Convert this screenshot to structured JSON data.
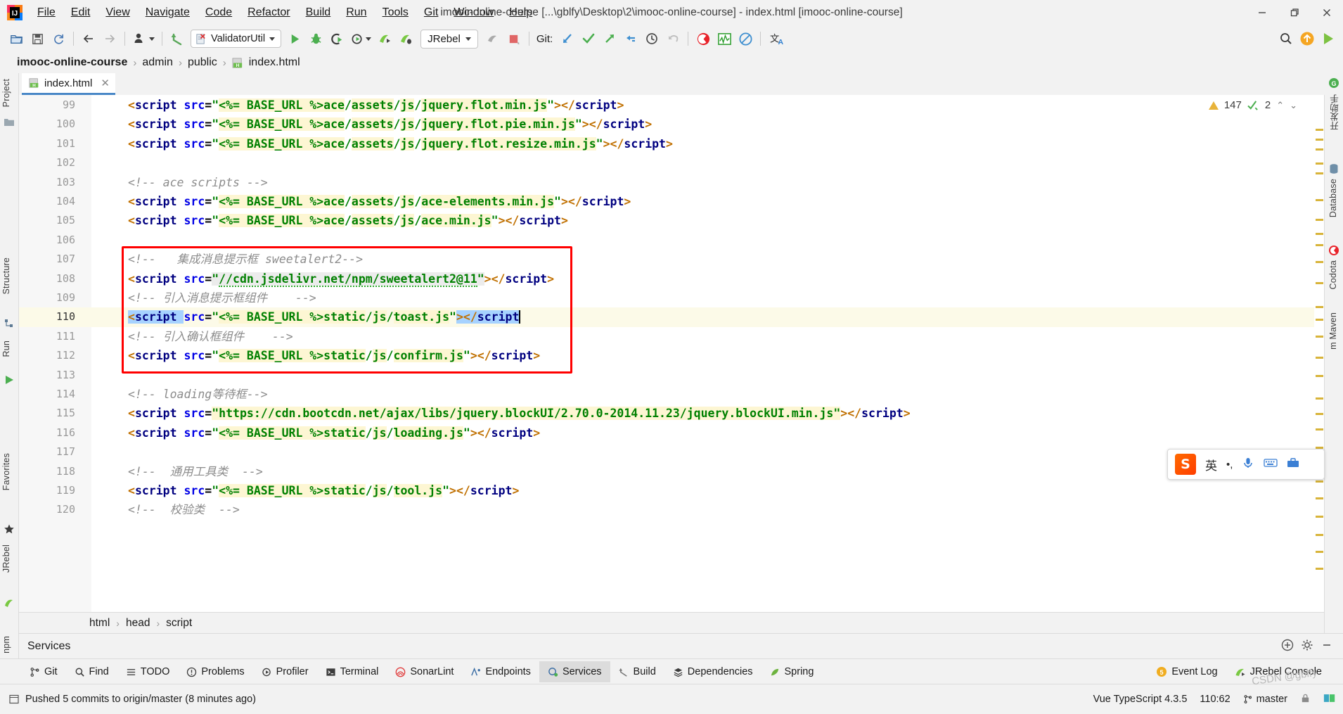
{
  "window": {
    "title": "imooc-online-course [...\\gblfy\\Desktop\\2\\imooc-online-course] - index.html [imooc-online-course]",
    "minimize": "—",
    "maximize": "❐",
    "close": "✕"
  },
  "menu": [
    {
      "label": "File"
    },
    {
      "label": "Edit"
    },
    {
      "label": "View"
    },
    {
      "label": "Navigate"
    },
    {
      "label": "Code"
    },
    {
      "label": "Refactor"
    },
    {
      "label": "Build"
    },
    {
      "label": "Run"
    },
    {
      "label": "Tools"
    },
    {
      "label": "Git"
    },
    {
      "label": "Window"
    },
    {
      "label": "Help"
    }
  ],
  "toolbar": {
    "run_config": "ValidatorUtil",
    "jrebel": "JRebel",
    "git_label": "Git:",
    "icons": [
      "open-folder-icon",
      "save-all-icon",
      "sync-icon",
      "back-icon",
      "forward-icon",
      "profile-icon",
      "undo-arrow-icon",
      "run-icon",
      "debug-icon",
      "run-with-coverage-icon",
      "profiler-icon",
      "jrebel-run-icon",
      "jrebel-debug-icon",
      "stop-icon",
      "pause-icon",
      "git-update-icon",
      "git-commit-icon",
      "git-push-icon",
      "git-pull-icon",
      "git-history-icon",
      "git-rollback-icon",
      "codota-icon",
      "monitor-icon",
      "block-icon",
      "translate-icon",
      "search-everywhere-icon",
      "upload-icon",
      "play-green-icon"
    ]
  },
  "breadcrumb": {
    "items": [
      "imooc-online-course",
      "admin",
      "public",
      "index.html"
    ],
    "separator": "›",
    "file_icon": "html-file-icon"
  },
  "tab": {
    "label": "index.html",
    "icon": "html-file-icon",
    "close": "✕"
  },
  "left_stripe": [
    {
      "label": "Project",
      "name": "tool-window-project"
    },
    {
      "label": "Structure",
      "name": "tool-window-structure"
    },
    {
      "label": "Run",
      "name": "tool-window-run"
    },
    {
      "label": "Favorites",
      "name": "tool-window-favorites"
    },
    {
      "label": "JRebel",
      "name": "tool-window-jrebel"
    },
    {
      "label": "npm",
      "name": "tool-window-npm"
    }
  ],
  "right_stripe": [
    {
      "label": "开发助手",
      "name": "tool-window-dev-helper"
    },
    {
      "label": "Database",
      "name": "tool-window-database"
    },
    {
      "label": "Codota",
      "name": "tool-window-codota"
    },
    {
      "label": "m Maven",
      "name": "tool-window-maven"
    }
  ],
  "inspection": {
    "warning_count": "147",
    "check_count": "2",
    "warning_icon": "warning-triangle-icon",
    "check_icon": "inspection-check-icon",
    "up_chevron": "⌃",
    "down_chevron": "⌄"
  },
  "code": {
    "first_line": 99,
    "current_line": 110,
    "lines": [
      {
        "n": 99,
        "html": "<span class=\"t-angle\">&lt;</span><span class=\"t-tag\">script </span><span class=\"t-attr\">src</span><span class=\"t-eq\">=</span><span class=\"t-str\">\"</span><span class=\"hl\"><span class=\"t-str\">&lt;%= BASE_URL %&gt;ace</span></span><span class=\"t-str\">/</span><span class=\"hl\"><span class=\"t-str\">assets</span></span><span class=\"t-str\">/</span><span class=\"hl\"><span class=\"t-str\">js</span></span><span class=\"t-str\">/</span><span class=\"hl\"><span class=\"t-str\">jquery.flot.min.js</span></span><span class=\"t-str\">\"</span><span class=\"t-angle\">&gt;&lt;/</span><span class=\"t-tag\">script</span><span class=\"t-angle\">&gt;</span>"
      },
      {
        "n": 100,
        "html": "<span class=\"t-angle\">&lt;</span><span class=\"t-tag\">script </span><span class=\"t-attr\">src</span><span class=\"t-eq\">=</span><span class=\"t-str\">\"</span><span class=\"hl\"><span class=\"t-str\">&lt;%= BASE_URL %&gt;ace</span></span><span class=\"t-str\">/</span><span class=\"hl\"><span class=\"t-str\">assets</span></span><span class=\"t-str\">/</span><span class=\"hl\"><span class=\"t-str\">js</span></span><span class=\"t-str\">/</span><span class=\"hl\"><span class=\"t-str\">jquery.flot.pie.min.js</span></span><span class=\"t-str\">\"</span><span class=\"t-angle\">&gt;&lt;/</span><span class=\"t-tag\">script</span><span class=\"t-angle\">&gt;</span>"
      },
      {
        "n": 101,
        "html": "<span class=\"t-angle\">&lt;</span><span class=\"t-tag\">script </span><span class=\"t-attr\">src</span><span class=\"t-eq\">=</span><span class=\"t-str\">\"</span><span class=\"hl\"><span class=\"t-str\">&lt;%= BASE_URL %&gt;ace</span></span><span class=\"t-str\">/</span><span class=\"hl\"><span class=\"t-str\">assets</span></span><span class=\"t-str\">/</span><span class=\"hl\"><span class=\"t-str\">js</span></span><span class=\"t-str\">/</span><span class=\"hl\"><span class=\"t-str\">jquery.flot.resize.min.js</span></span><span class=\"t-str\">\"</span><span class=\"t-angle\">&gt;&lt;/</span><span class=\"t-tag\">script</span><span class=\"t-angle\">&gt;</span>"
      },
      {
        "n": 102,
        "html": ""
      },
      {
        "n": 103,
        "html": "<span class=\"t-cmt\">&lt;!-- ace scripts --&gt;</span>"
      },
      {
        "n": 104,
        "html": "<span class=\"t-angle\">&lt;</span><span class=\"t-tag\">script </span><span class=\"t-attr\">src</span><span class=\"t-eq\">=</span><span class=\"t-str\">\"</span><span class=\"hl\"><span class=\"t-str\">&lt;%= BASE_URL %&gt;ace</span></span><span class=\"t-str\">/</span><span class=\"hl\"><span class=\"t-str\">assets</span></span><span class=\"t-str\">/</span><span class=\"hl\"><span class=\"t-str\">js</span></span><span class=\"t-str\">/</span><span class=\"hl\"><span class=\"t-str\">ace-elements.min.js</span></span><span class=\"t-str\">\"</span><span class=\"t-angle\">&gt;&lt;/</span><span class=\"t-tag\">script</span><span class=\"t-angle\">&gt;</span>"
      },
      {
        "n": 105,
        "html": "<span class=\"t-angle\">&lt;</span><span class=\"t-tag\">script </span><span class=\"t-attr\">src</span><span class=\"t-eq\">=</span><span class=\"t-str\">\"</span><span class=\"hl\"><span class=\"t-str\">&lt;%= BASE_URL %&gt;ace</span></span><span class=\"t-str\">/</span><span class=\"hl\"><span class=\"t-str\">assets</span></span><span class=\"t-str\">/</span><span class=\"hl\"><span class=\"t-str\">js</span></span><span class=\"t-str\">/</span><span class=\"hl\"><span class=\"t-str\">ace.min.js</span></span><span class=\"t-str\">\"</span><span class=\"t-angle\">&gt;&lt;/</span><span class=\"t-tag\">script</span><span class=\"t-angle\">&gt;</span>"
      },
      {
        "n": 106,
        "html": ""
      },
      {
        "n": 107,
        "html": "<span class=\"t-cmt\">&lt;!--   集成消息提示框 sweetalert2--&gt;</span>"
      },
      {
        "n": 108,
        "html": "<span class=\"t-angle\">&lt;</span><span class=\"t-tag\">script </span><span class=\"t-attr\">src</span><span class=\"t-eq\">=</span><span class=\"hl2\"><span class=\"t-str\">\"</span><span class=\"t-str wavy\">//cdn.jsdelivr.net/npm/sweetalert2@11</span><span class=\"t-str\">\"</span></span><span class=\"t-angle\">&gt;&lt;/</span><span class=\"t-tag\">script</span><span class=\"t-angle\">&gt;</span>"
      },
      {
        "n": 109,
        "html": "<span class=\"t-cmt\">&lt;!-- 引入消息提示框组件    --&gt;</span>"
      },
      {
        "n": 110,
        "html": "<span class=\"sel\"><span class=\"t-angle\">&lt;</span><span class=\"t-tag\">script </span></span><span class=\"t-attr\">src</span><span class=\"t-eq\">=</span><span class=\"t-str\">\"</span><span class=\"hl\"><span class=\"t-str\">&lt;%= BASE_URL %&gt;static</span></span><span class=\"t-str\">/</span><span class=\"hl\"><span class=\"t-str\">js</span></span><span class=\"t-str\">/</span><span class=\"hl\"><span class=\"t-str\">toast.js</span></span><span class=\"t-str\">\"</span><span class=\"sel\"><span class=\"t-angle\">&gt;&lt;/</span><span class=\"t-tag\">script</span></span><span class=\"caret\"></span>"
      },
      {
        "n": 111,
        "html": "<span class=\"t-cmt\">&lt;!-- 引入确认框组件    --&gt;</span>"
      },
      {
        "n": 112,
        "html": "<span class=\"t-angle\">&lt;</span><span class=\"t-tag\">script </span><span class=\"t-attr\">src</span><span class=\"t-eq\">=</span><span class=\"t-str\">\"</span><span class=\"hl\"><span class=\"t-str\">&lt;%= BASE_URL %&gt;static</span></span><span class=\"t-str\">/</span><span class=\"hl\"><span class=\"t-str\">js</span></span><span class=\"t-str\">/</span><span class=\"hl\"><span class=\"t-str\">confirm.js</span></span><span class=\"t-str\">\"</span><span class=\"t-angle\">&gt;&lt;/</span><span class=\"t-tag\">script</span><span class=\"t-angle\">&gt;</span>"
      },
      {
        "n": 113,
        "html": ""
      },
      {
        "n": 114,
        "html": "<span class=\"t-cmt\">&lt;!-- loading等待框--&gt;</span>"
      },
      {
        "n": 115,
        "html": "<span class=\"t-angle\">&lt;</span><span class=\"t-tag\">script </span><span class=\"t-attr\">src</span><span class=\"t-eq\">=</span><span class=\"hl\"><span class=\"t-str\">\"https://cdn.bootcdn.net/ajax/libs/jquery.blockUI/2.70.0-2014.11.23/jquery.blockUI.min.js\"</span></span><span class=\"t-angle\">&gt;&lt;/</span><span class=\"t-tag\">script</span><span class=\"t-angle\">&gt;</span>"
      },
      {
        "n": 116,
        "html": "<span class=\"t-angle\">&lt;</span><span class=\"t-tag\">script </span><span class=\"t-attr\">src</span><span class=\"t-eq\">=</span><span class=\"t-str\">\"</span><span class=\"hl\"><span class=\"t-str\">&lt;%= BASE_URL %&gt;static</span></span><span class=\"t-str\">/</span><span class=\"hl\"><span class=\"t-str\">js</span></span><span class=\"t-str\">/</span><span class=\"hl\"><span class=\"t-str\">loading.js</span></span><span class=\"t-str\">\"</span><span class=\"t-angle\">&gt;&lt;/</span><span class=\"t-tag\">script</span><span class=\"t-angle\">&gt;</span>"
      },
      {
        "n": 117,
        "html": ""
      },
      {
        "n": 118,
        "html": "<span class=\"t-cmt\">&lt;!--  通用工具类  --&gt;</span>"
      },
      {
        "n": 119,
        "html": "<span class=\"t-angle\">&lt;</span><span class=\"t-tag\">script </span><span class=\"t-attr\">src</span><span class=\"t-eq\">=</span><span class=\"t-str\">\"</span><span class=\"hl\"><span class=\"t-str\">&lt;%= BASE_URL %&gt;static</span></span><span class=\"t-str\">/</span><span class=\"hl\"><span class=\"t-str\">js</span></span><span class=\"t-str\">/</span><span class=\"hl\"><span class=\"t-str\">tool.js</span></span><span class=\"t-str\">\"</span><span class=\"t-angle\">&gt;&lt;/</span><span class=\"t-tag\">script</span><span class=\"t-angle\">&gt;</span>"
      },
      {
        "n": 120,
        "html": "<span class=\"t-cmt\">&lt;!--  校验类  --&gt;</span>"
      }
    ]
  },
  "bottom_breadcrumb": {
    "items": [
      "html",
      "head",
      "script"
    ],
    "separator": "›"
  },
  "services_panel": {
    "title": "Services",
    "icons": [
      "add-service-icon",
      "settings-gear-icon",
      "hide-icon"
    ]
  },
  "tool_window_buttons": [
    {
      "label": "Git",
      "icon": "git-branch-icon",
      "active": false
    },
    {
      "label": "Find",
      "icon": "search-icon",
      "active": false
    },
    {
      "label": "TODO",
      "icon": "todo-list-icon",
      "active": false
    },
    {
      "label": "Problems",
      "icon": "problems-icon",
      "active": false
    },
    {
      "label": "Profiler",
      "icon": "profiler-icon",
      "active": false
    },
    {
      "label": "Terminal",
      "icon": "terminal-icon",
      "active": false
    },
    {
      "label": "SonarLint",
      "icon": "sonarlint-icon",
      "active": false
    },
    {
      "label": "Endpoints",
      "icon": "endpoints-icon",
      "active": false
    },
    {
      "label": "Services",
      "icon": "services-icon",
      "active": true
    },
    {
      "label": "Build",
      "icon": "build-hammer-icon",
      "active": false
    },
    {
      "label": "Dependencies",
      "icon": "dependencies-icon",
      "active": false
    },
    {
      "label": "Spring",
      "icon": "spring-leaf-icon",
      "active": false
    }
  ],
  "tool_window_right": [
    {
      "label": "Event Log",
      "icon": "event-log-icon",
      "badge": "5"
    },
    {
      "label": "JRebel Console",
      "icon": "jrebel-icon",
      "badge": ""
    }
  ],
  "status_bar": {
    "message": "Pushed 5 commits to origin/master (8 minutes ago)",
    "message_icon": "notification-icon",
    "framework": "Vue TypeScript 4.3.5",
    "caret_position": "110:62",
    "branch": "master",
    "branch_icon": "git-branch-icon",
    "lock_icon": "lock-icon",
    "indicator_icon": "memory-indicator-icon"
  },
  "ime_bar": {
    "logo": "S",
    "mode": "英",
    "punct": "•,",
    "icons": [
      "mic-icon",
      "keyboard-icon",
      "toolbox-icon"
    ]
  },
  "watermark": "CSDN @gblfy",
  "colors": {
    "accent_blue": "#4a88c7",
    "string_green": "#008000",
    "tag_navy": "#000080",
    "attr_blue": "#0000e6",
    "comment_gray": "#8c8c8c",
    "highlight_yellow": "#fdf6d3",
    "selection_blue": "#a6d2ff",
    "annotation_red": "#ff0000",
    "current_line": "#fcfae8"
  }
}
